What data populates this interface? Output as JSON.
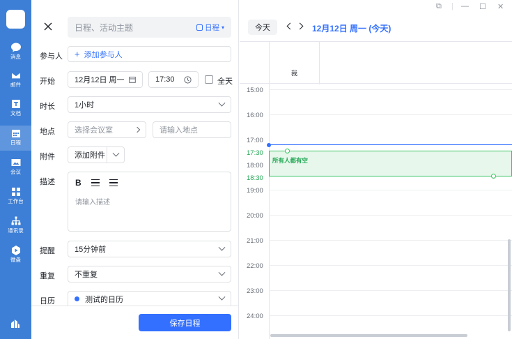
{
  "sidebar": {
    "items": [
      {
        "label": "消息",
        "icon": "chat-bubble-icon"
      },
      {
        "label": "邮件",
        "icon": "mail-icon"
      },
      {
        "label": "文档",
        "icon": "document-icon"
      },
      {
        "label": "日程",
        "icon": "calendar-icon",
        "active": true
      },
      {
        "label": "会议",
        "icon": "video-meeting-icon"
      },
      {
        "label": "工作台",
        "icon": "workbench-grid-icon"
      },
      {
        "label": "通讯录",
        "icon": "contacts-icon"
      },
      {
        "label": "微盘",
        "icon": "drive-icon"
      }
    ]
  },
  "form": {
    "title_placeholder": "日程、活动主题",
    "calendar_selector": "日程",
    "attendees_label": "参与人",
    "attendees_add": "添加参与人",
    "start_label": "开始",
    "start_date": "12月12日 周一",
    "start_time": "17:30",
    "allday_label": "全天",
    "duration_label": "时长",
    "duration_value": "1小时",
    "location_label": "地点",
    "room_placeholder": "选择会议室",
    "location_placeholder": "请输入地点",
    "attachment_label": "附件",
    "attachment_add": "添加附件",
    "description_label": "描述",
    "description_bold": "B",
    "description_placeholder": "请输入描述",
    "reminder_label": "提醒",
    "reminder_value": "15分钟前",
    "repeat_label": "重复",
    "repeat_value": "不重复",
    "calendar_label": "日历",
    "calendar_value": "测试的日历",
    "save_button": "保存日程"
  },
  "calendar": {
    "today_button": "今天",
    "date_title": "12月12日 周一 (今天)",
    "attendee_column": "我",
    "time_labels": [
      "15:00",
      "16:00",
      "17:00",
      "17:30",
      "18:00",
      "18:30",
      "19:00",
      "20:00",
      "21:00",
      "22:00",
      "23:00",
      "24:00"
    ],
    "selected_slot_text": "所有人都有空",
    "accent_color": "#3370ff",
    "free_slot_color": "#34c25d"
  }
}
